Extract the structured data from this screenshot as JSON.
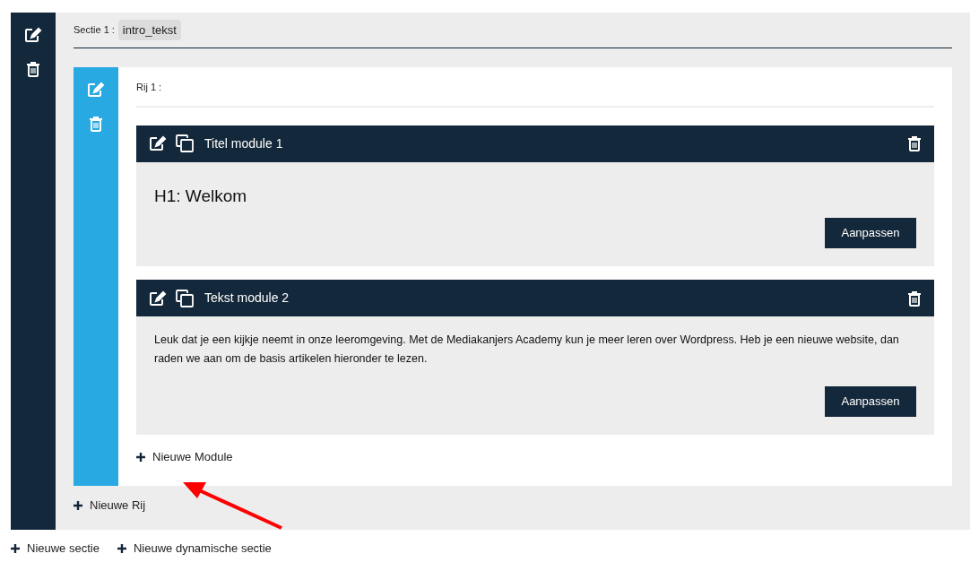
{
  "section": {
    "label": "Sectie 1 :",
    "name": "intro_tekst",
    "rows": [
      {
        "label": "Rij 1 :",
        "modules": [
          {
            "kind": "heading",
            "title": "Titel module 1",
            "content": "H1: Welkom",
            "button": "Aanpassen"
          },
          {
            "kind": "text",
            "title": "Tekst module 2",
            "content": "Leuk dat je een kijkje neemt in onze leeromgeving. Met de Mediakanjers Academy kun je meer leren over Wordpress. Heb je een nieuwe website, dan raden we aan om de basis artikelen hieronder te lezen.",
            "button": "Aanpassen"
          }
        ],
        "add_module": "Nieuwe Module"
      }
    ],
    "add_row": "Nieuwe Rij"
  },
  "actions": [
    "Nieuwe sectie",
    "Nieuwe dynamische sectie"
  ]
}
